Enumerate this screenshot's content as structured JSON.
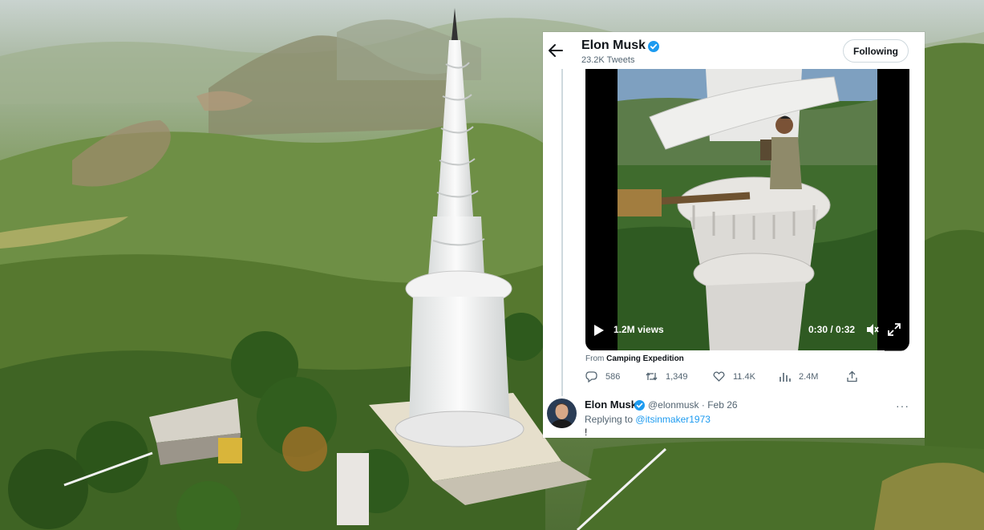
{
  "profile": {
    "name": "Elon Musk",
    "tweets": "23.2K Tweets",
    "follow_label": "Following"
  },
  "video": {
    "views": "1.2M views",
    "time": "0:30 / 0:32",
    "progress": 0.94
  },
  "source": {
    "prefix": "From",
    "name": "Camping Expedition"
  },
  "actions": {
    "replies": "586",
    "retweets": "1,349",
    "likes": "11.4K",
    "views": "2.4M"
  },
  "reply": {
    "name": "Elon Musk",
    "handle_date": "@elonmusk · Feb 26",
    "replying_prefix": "Replying to",
    "replying_handle": "@itsinmaker1973",
    "text": "!"
  },
  "icons": {
    "back": "back-arrow-icon",
    "verified": "verified-badge-icon",
    "play": "play-icon",
    "volume": "volume-icon",
    "fullscreen": "fullscreen-icon",
    "reply": "reply-icon",
    "retweet": "retweet-icon",
    "like": "heart-icon",
    "views": "views-chart-icon",
    "share": "share-icon",
    "more": "more-icon"
  },
  "colors": {
    "accent": "#1d9bf0",
    "text": "#0f1419",
    "secondary": "#536471"
  }
}
